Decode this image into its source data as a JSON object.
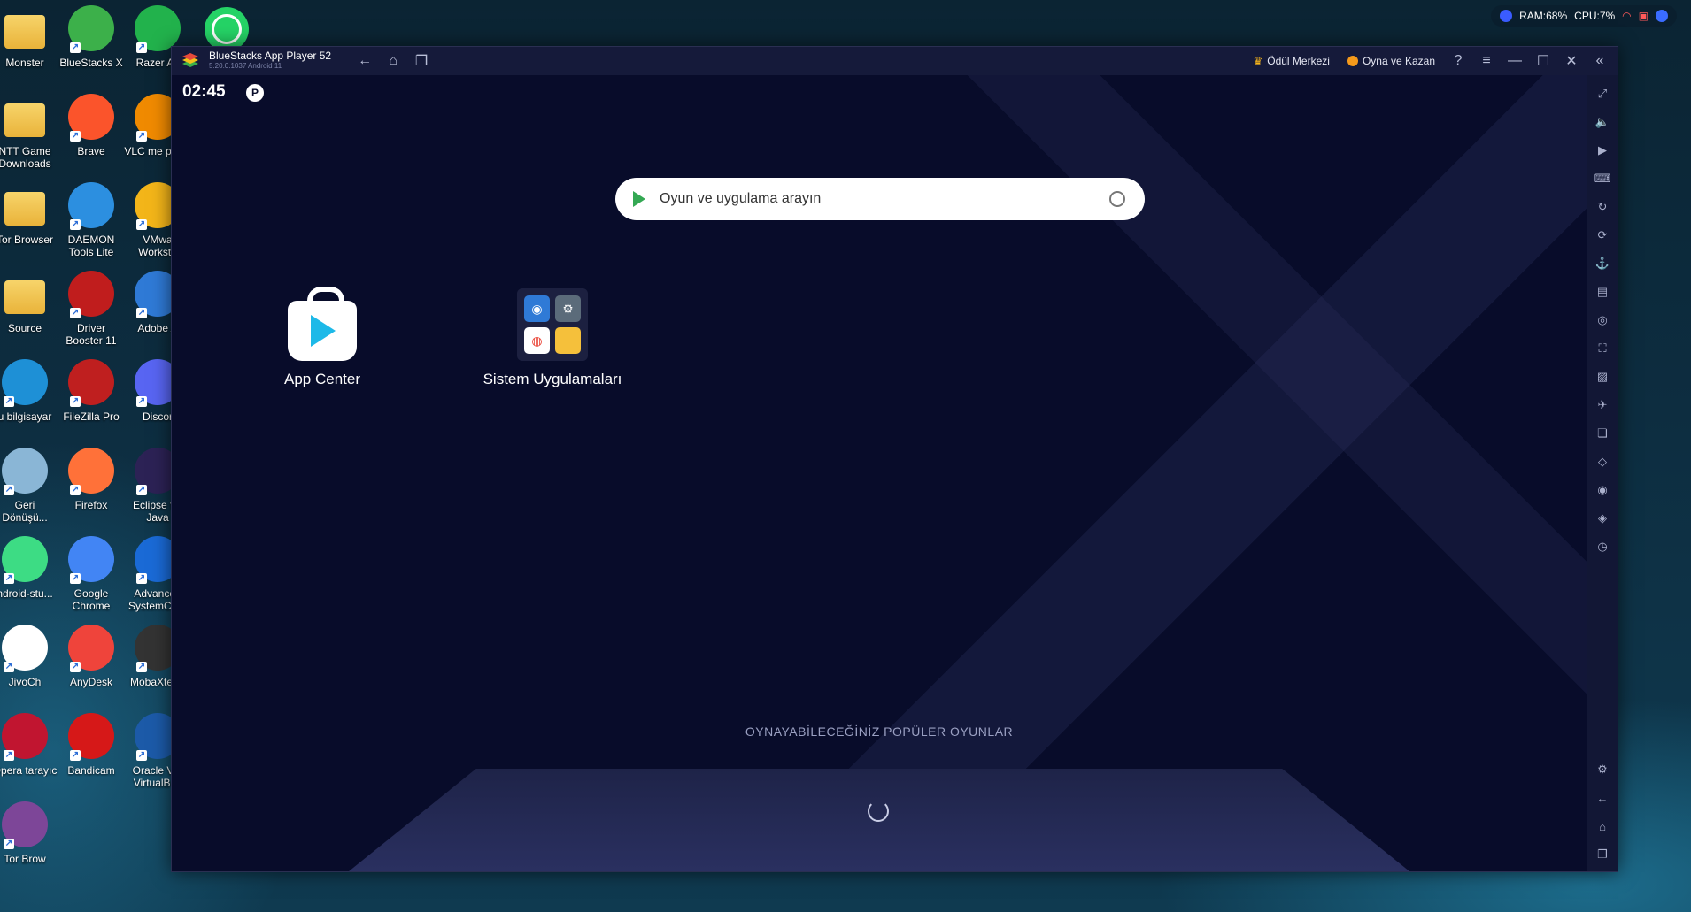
{
  "desktop": {
    "icons": [
      {
        "label": "Monster",
        "color": "#e9b33a"
      },
      {
        "label": "BlueStacks X",
        "color": "#3cb04a"
      },
      {
        "label": "Razer Ax",
        "color": "#22b24c"
      },
      {
        "label": "NTT Game Downloads",
        "color": "#e9b33a"
      },
      {
        "label": "Brave",
        "color": "#fb542b"
      },
      {
        "label": "VLC me playe",
        "color": "#f08a00"
      },
      {
        "label": "Tor Browser",
        "color": "#e9b33a"
      },
      {
        "label": "DAEMON Tools Lite",
        "color": "#2c8fe0"
      },
      {
        "label": "VMwa Worksta",
        "color": "#f3b519"
      },
      {
        "label": "Source",
        "color": "#e9b33a"
      },
      {
        "label": "Driver Booster 11",
        "color": "#c01d1d"
      },
      {
        "label": "Adobe A",
        "color": "#2f7ad6"
      },
      {
        "label": "u bilgisayar",
        "color": "#1e90d6"
      },
      {
        "label": "FileZilla Pro",
        "color": "#bf1f1f"
      },
      {
        "label": "Discor",
        "color": "#5865f2"
      },
      {
        "label": "Geri Dönüşü...",
        "color": "#8ab6d6"
      },
      {
        "label": "Firefox",
        "color": "#ff7139"
      },
      {
        "label": "Eclipse for Java",
        "color": "#2c2255"
      },
      {
        "label": "ndroid-stu...",
        "color": "#3ddc84"
      },
      {
        "label": "Google Chrome",
        "color": "#4285f4"
      },
      {
        "label": "Advanced SystemCare",
        "color": "#1a6ad6"
      },
      {
        "label": "JivoCh",
        "color": "#ffffff"
      },
      {
        "label": "AnyDesk",
        "color": "#ef443b"
      },
      {
        "label": "MobaXterm",
        "color": "#333333"
      },
      {
        "label": "Opera tarayıc",
        "color": "#c11530"
      },
      {
        "label": "Bandicam",
        "color": "#d61818"
      },
      {
        "label": "Oracle VM VirtualBox",
        "color": "#1c5aa8"
      },
      {
        "label": "Tor Brow",
        "color": "#7d4698"
      }
    ],
    "whatsapp_color": "#25d366"
  },
  "tray": {
    "ram": "RAM:68%",
    "cpu": "CPU:7%"
  },
  "window": {
    "title": "BlueStacks App Player 52",
    "version": "5.20.0.1037  Android 11",
    "reward_center": "Ödül Merkezi",
    "play_and_earn": "Oyna ve Kazan"
  },
  "android": {
    "time": "02:45",
    "search_placeholder": "Oyun ve uygulama arayın",
    "apps": [
      {
        "label": "App Center"
      },
      {
        "label": "Sistem Uygulamaları"
      }
    ],
    "popular_heading": "OYNAYABİLECEĞİNİZ POPÜLER OYUNLAR"
  },
  "sidebar_icons": [
    "fullscreen-icon",
    "volume-icon",
    "media-icon",
    "keyboard-icon",
    "replay-icon",
    "rotate-icon",
    "rpk-icon",
    "apk-icon",
    "screenshot-icon",
    "scale-icon",
    "gallery-icon",
    "airplane-icon",
    "multi-instance-icon",
    "eco-icon",
    "location-icon",
    "layers-icon",
    "macro-icon",
    "settings-icon",
    "back-icon",
    "home-icon",
    "recent-icon"
  ]
}
